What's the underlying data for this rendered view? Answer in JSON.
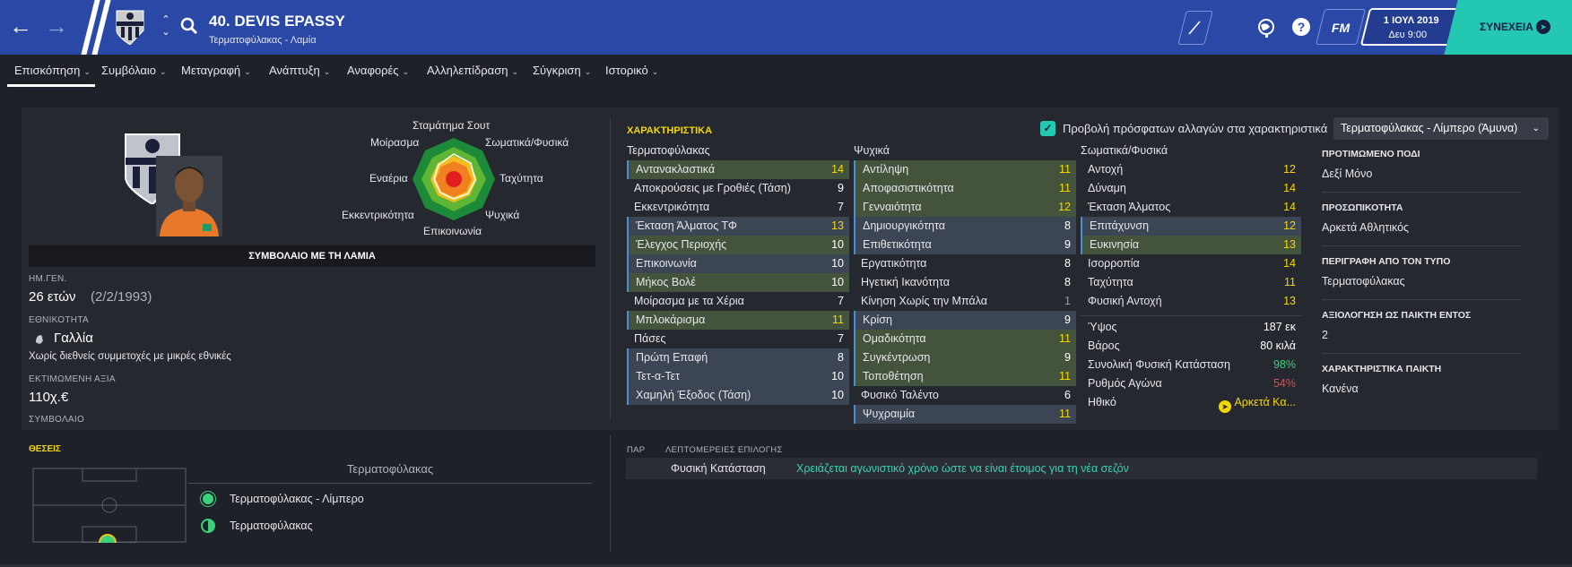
{
  "header": {
    "player_name": "40. DEVIS EPASSY",
    "player_subtitle": "Τερματοφύλακας - Λαμία",
    "fm_label": "FM",
    "date": "1 ΙΟΥΛ 2019",
    "day_time": "Δευ 9:00",
    "continue_label": "ΣΥΝΕΧΕΙΑ"
  },
  "menu": {
    "items": [
      "Επισκόπηση",
      "Συμβόλαιο",
      "Μεταγραφή",
      "Ανάπτυξη",
      "Αναφορές",
      "Αλληλεπίδραση",
      "Σύγκριση",
      "Ιστορικό"
    ]
  },
  "profile": {
    "contract_banner": "ΣΥΜΒΟΛΑΙΟ ΜΕ ΤΗ ΛΑΜΙΑ",
    "dob_label": "ΗΜ.ΓΕΝ.",
    "age": "26 ετών",
    "dob": "(2/2/1993)",
    "nationality_label": "ΕΘΝΙΚΟΤΗΤΑ",
    "nationality": "Γαλλία",
    "intl_note": "Χωρίς διεθνείς συμμετοχές με μικρές εθνικές",
    "value_label": "ΕΚΤΙΜΩΜΕΝΗ ΑΞΙΑ",
    "value": "110χ.€",
    "contract_label": "ΣΥΜΒΟΛΑΙΟ"
  },
  "radar": {
    "labels": [
      "Σταμάτημα Σουτ",
      "Σωματικά/Φυσικά",
      "Ταχύτητα",
      "Ψυχικά",
      "Επικοινωνία",
      "Εκκεντρικότητα",
      "Εναέρια",
      "Μοίρασμα"
    ]
  },
  "attributes": {
    "title": "ΧΑΡΑΚΤΗΡΙΣΤΙΚΑ",
    "show_changes_label": "Προβολή πρόσφατων αλλαγών στα χαρακτηριστικά",
    "role_dropdown": "Τερματοφύλακας - Λίμπερο (Άμυνα)",
    "gk_head": "Τερματοφύλακας",
    "mental_head": "Ψυχικά",
    "physical_head": "Σωματικά/Φυσικά",
    "goalkeeping": [
      {
        "name": "Αντανακλαστικά",
        "value": "14"
      },
      {
        "name": "Αποκρούσεις με Γροθιές (Τάση)",
        "value": "9"
      },
      {
        "name": "Εκκεντρικότητα",
        "value": "7"
      },
      {
        "name": "Έκταση Άλματος ΤΦ",
        "value": "13"
      },
      {
        "name": "Έλεγχος Περιοχής",
        "value": "10"
      },
      {
        "name": "Επικοινωνία",
        "value": "10"
      },
      {
        "name": "Μήκος Βολέ",
        "value": "10"
      },
      {
        "name": "Μοίρασμα με τα Χέρια",
        "value": "7"
      },
      {
        "name": "Μπλοκάρισμα",
        "value": "11"
      },
      {
        "name": "Πάσες",
        "value": "7"
      },
      {
        "name": "Πρώτη Επαφή",
        "value": "8"
      },
      {
        "name": "Τετ-α-Τετ",
        "value": "10"
      },
      {
        "name": "Χαμηλή Έξοδος (Τάση)",
        "value": "10"
      }
    ],
    "mental": [
      {
        "name": "Αντίληψη",
        "value": "11"
      },
      {
        "name": "Αποφασιστικότητα",
        "value": "11"
      },
      {
        "name": "Γενναιότητα",
        "value": "12"
      },
      {
        "name": "Δημιουργικότητα",
        "value": "8"
      },
      {
        "name": "Επιθετικότητα",
        "value": "9"
      },
      {
        "name": "Εργατικότητα",
        "value": "8"
      },
      {
        "name": "Ηγετική Ικανότητα",
        "value": "8"
      },
      {
        "name": "Κίνηση Χωρίς την Μπάλα",
        "value": "1"
      },
      {
        "name": "Κρίση",
        "value": "9"
      },
      {
        "name": "Ομαδικότητα",
        "value": "11"
      },
      {
        "name": "Συγκέντρωση",
        "value": "9"
      },
      {
        "name": "Τοποθέτηση",
        "value": "11"
      },
      {
        "name": "Φυσικό Ταλέντο",
        "value": "6"
      },
      {
        "name": "Ψυχραιμία",
        "value": "11"
      }
    ],
    "physical": [
      {
        "name": "Αντοχή",
        "value": "12"
      },
      {
        "name": "Δύναμη",
        "value": "14"
      },
      {
        "name": "Έκταση Άλματος",
        "value": "14"
      },
      {
        "name": "Επιτάχυνση",
        "value": "12"
      },
      {
        "name": "Ευκινησία",
        "value": "13"
      },
      {
        "name": "Ισορροπία",
        "value": "14"
      },
      {
        "name": "Ταχύτητα",
        "value": "11"
      },
      {
        "name": "Φυσική Αντοχή",
        "value": "13"
      }
    ],
    "extra": [
      {
        "name": "Ύψος",
        "value": "187 εκ"
      },
      {
        "name": "Βάρος",
        "value": "80 κιλά"
      },
      {
        "name": "Συνολική Φυσική Κατάσταση",
        "value": "98%"
      },
      {
        "name": "Ρυθμός Αγώνα",
        "value": "54%"
      },
      {
        "name": "Ηθικό",
        "value": "Αρκετά Κα..."
      }
    ]
  },
  "info": {
    "foot_label": "ΠΡΟΤΙΜΩΜΕΝΟ ΠΟΔΙ",
    "foot": "Δεξί Μόνο",
    "personality_label": "ΠΡΟΣΩΠΙΚΟΤΗΤΑ",
    "personality": "Αρκετά Αθλητικός",
    "media_label": "ΠΕΡΙΓΡΑΦΗ ΑΠΟ ΤΟΝ ΤΥΠΟ",
    "media": "Τερματοφύλακας",
    "rating_label": "ΑΞΙΟΛΟΓΗΣΗ ΩΣ ΠΑΙΚΤΗ ΕΝΤΟΣ",
    "rating": "2",
    "traits_label": "ΧΑΡΑΚΤΗΡΙΣΤΙΚΑ ΠΑΙΚΤΗ",
    "traits": "Κανένα"
  },
  "positions": {
    "title": "ΘΕΣΕΙΣ",
    "heading": "Τερματοφύλακας",
    "list": [
      {
        "name": "Τερματοφύλακας - Λίμπερο"
      },
      {
        "name": "Τερματοφύλακας"
      }
    ]
  },
  "selection": {
    "col1": "ΠΑΡ",
    "col2": "ΛΕΠΤΟΜΕΡΕΙΕΣ ΕΠΙΛΟΓΗΣ",
    "row_label": "Φυσική Κατάσταση",
    "row_text": "Χρειάζεται αγωνιστικό χρόνο ώστε να είναι έτοιμος για τη νέα σεζόν"
  },
  "colors": {
    "header": "#2a48a6",
    "accent": "#24c8b2",
    "highlight_yellow": "#f5d700",
    "good_green": "#39d27a",
    "bad_red": "#e0504a"
  }
}
